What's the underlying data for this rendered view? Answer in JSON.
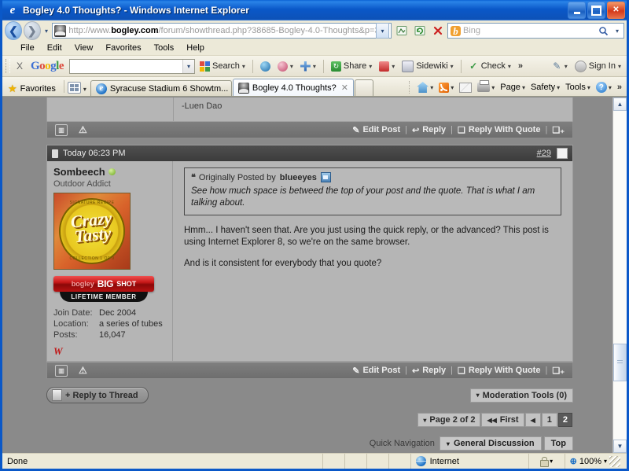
{
  "window": {
    "title": "Bogley 4.0 Thoughts? - Windows Internet Explorer",
    "minimize": "_",
    "maximize": "□",
    "close": "✕"
  },
  "address_bar": {
    "back_icon": "◀",
    "forward_icon": "▶",
    "history_caret": "▾",
    "url_prefix": "http://www.",
    "url_domain": "bogley.com",
    "url_suffix": "/forum/showthread.php?38685-Bogley-4.0-Thoughts&p=396905#p",
    "url_caret": "▾",
    "compat_icon": "compatibility-view-icon",
    "refresh_icon": "↻",
    "stop_icon": "✕",
    "search_engine": "b",
    "search_placeholder": "Bing",
    "search_go_icon": "⌕",
    "search_caret": "▾"
  },
  "menu_bar": {
    "items": [
      {
        "label": "File"
      },
      {
        "label": "Edit"
      },
      {
        "label": "View"
      },
      {
        "label": "Favorites"
      },
      {
        "label": "Tools"
      },
      {
        "label": "Help"
      }
    ]
  },
  "google_toolbar": {
    "close_label": "X",
    "logo": [
      "G",
      "o",
      "o",
      "g",
      "l",
      "e"
    ],
    "search_value": "",
    "dropdown_caret": "▾",
    "items": [
      {
        "label": "Search",
        "icon": "google-colors-icon"
      },
      {
        "label": "",
        "icon": "translate-globe-icon"
      },
      {
        "label": "",
        "icon": "bookmarks-icon"
      },
      {
        "label": "",
        "icon": "plus-icon"
      },
      {
        "label": "Share",
        "icon": "share-icon"
      },
      {
        "label": "",
        "icon": "blocked-icon"
      },
      {
        "label": "Sidewiki",
        "icon": "sidewiki-icon"
      },
      {
        "label": "Check",
        "icon": "spellcheck-icon"
      }
    ],
    "overflow": "»",
    "settings_icon": "wrench-icon",
    "signin_label": "Sign In"
  },
  "fav_bar": {
    "favorites_label": "Favorites",
    "favorites_star": "★",
    "grid_caret": "▾",
    "tabs": [
      {
        "label": "Syracuse Stadium 6 Showtm...",
        "icon": "ie-icon",
        "active": false
      },
      {
        "label": "Bogley 4.0 Thoughts?",
        "icon": "bogley-icon",
        "active": true,
        "close": "✕"
      }
    ],
    "command_bar": {
      "items": [
        {
          "label": "",
          "icon": "home-icon",
          "caret": "▾"
        },
        {
          "label": "",
          "icon": "rss-icon",
          "caret": "▾"
        },
        {
          "label": "",
          "icon": "mail-icon",
          "caret": ""
        },
        {
          "label": "",
          "icon": "print-icon",
          "caret": "▾"
        },
        {
          "label": "Page",
          "icon": "",
          "caret": "▾"
        },
        {
          "label": "Safety",
          "icon": "",
          "caret": "▾"
        },
        {
          "label": "Tools",
          "icon": "",
          "caret": "▾"
        },
        {
          "label": "",
          "icon": "help-icon",
          "caret": "▾"
        }
      ],
      "overflow": "»"
    }
  },
  "page": {
    "previous_post_tail": "-Luen Dao",
    "post_footer_top": {
      "multiquote_icon": "multiquote-icon",
      "report_icon": "report-post-icon",
      "links": [
        "Edit Post",
        "Reply",
        "Reply With Quote"
      ],
      "separator": "|",
      "quote_plus_icon": "multi-quote-plus-icon"
    },
    "post": {
      "header": {
        "date": "Today 06:23 PM",
        "post_number": "#29",
        "checkbox": "post-select-checkbox"
      },
      "user": {
        "name": "Sombeech",
        "online_indicator": "online-status-icon",
        "title": "Outdoor Addict",
        "avatar_text": "Crazy Tasty",
        "avatar_top_text": "SIGNATURE RECIPE",
        "avatar_bottom_text": "COLLECTION 1 OF 9",
        "badge_brand": "bogley",
        "badge_big": "BIG",
        "badge_shot": "SHOT",
        "badge_sub": "LIFETIME MEMBER",
        "stats": [
          {
            "key": "Join Date:",
            "value": "Dec 2004"
          },
          {
            "key": "Location:",
            "value": "a series of tubes"
          },
          {
            "key": "Posts:",
            "value": "16,047"
          }
        ],
        "signature_icon": "W"
      },
      "quote": {
        "marker": "❝",
        "prefix": "Originally Posted by",
        "author": "blueeyes",
        "jump_icon": "view-post-icon",
        "text": "See how much space is betweed the top of your post and the quote. That is what I am talking about."
      },
      "paragraphs": [
        "Hmm... I haven't seen that. Are you just using the quick reply, or the advanced? This post is using Internet Explorer 8, so we're on the same browser.",
        "And is it consistent for everybody that you quote?"
      ]
    },
    "post_footer_bottom": {
      "multiquote_icon": "multiquote-icon",
      "report_icon": "report-post-icon",
      "links": [
        "Edit Post",
        "Reply",
        "Reply With Quote"
      ],
      "separator": "|",
      "quote_plus_icon": "multi-quote-plus-icon"
    },
    "reply_button": {
      "label": "+ Reply to Thread",
      "icon": "reply-pencil-icon"
    },
    "moderation_tools": {
      "caret": "▾",
      "label": "Moderation Tools (0)"
    },
    "pagination": {
      "caret": "▾",
      "page_label": "Page 2 of 2",
      "first_label": "First",
      "first_icon": "◀◀",
      "prev_icon": "◀",
      "pages": [
        {
          "label": "1",
          "current": false
        },
        {
          "label": "2",
          "current": true
        }
      ]
    },
    "quick_navigation": {
      "label": "Quick Navigation",
      "caret": "▾",
      "forum": "General Discussion",
      "top": "Top"
    }
  },
  "scrollbar": {
    "up_icon": "▲",
    "down_icon": "▼"
  },
  "status_bar": {
    "status": "Done",
    "zone": "Internet",
    "zone_icon": "internet-zone-icon",
    "security_icon": "protected-mode-icon",
    "security_caret": "▾",
    "zoom_icon": "zoom-icon",
    "zoom": "100%",
    "zoom_caret": "▾"
  },
  "colors": {
    "titlebar": "#0a58c8",
    "chrome": "#ece9d8",
    "page_bg": "#8a8a8a",
    "post_bg": "#b5b5b5",
    "post_header": "#3c3c3c"
  }
}
